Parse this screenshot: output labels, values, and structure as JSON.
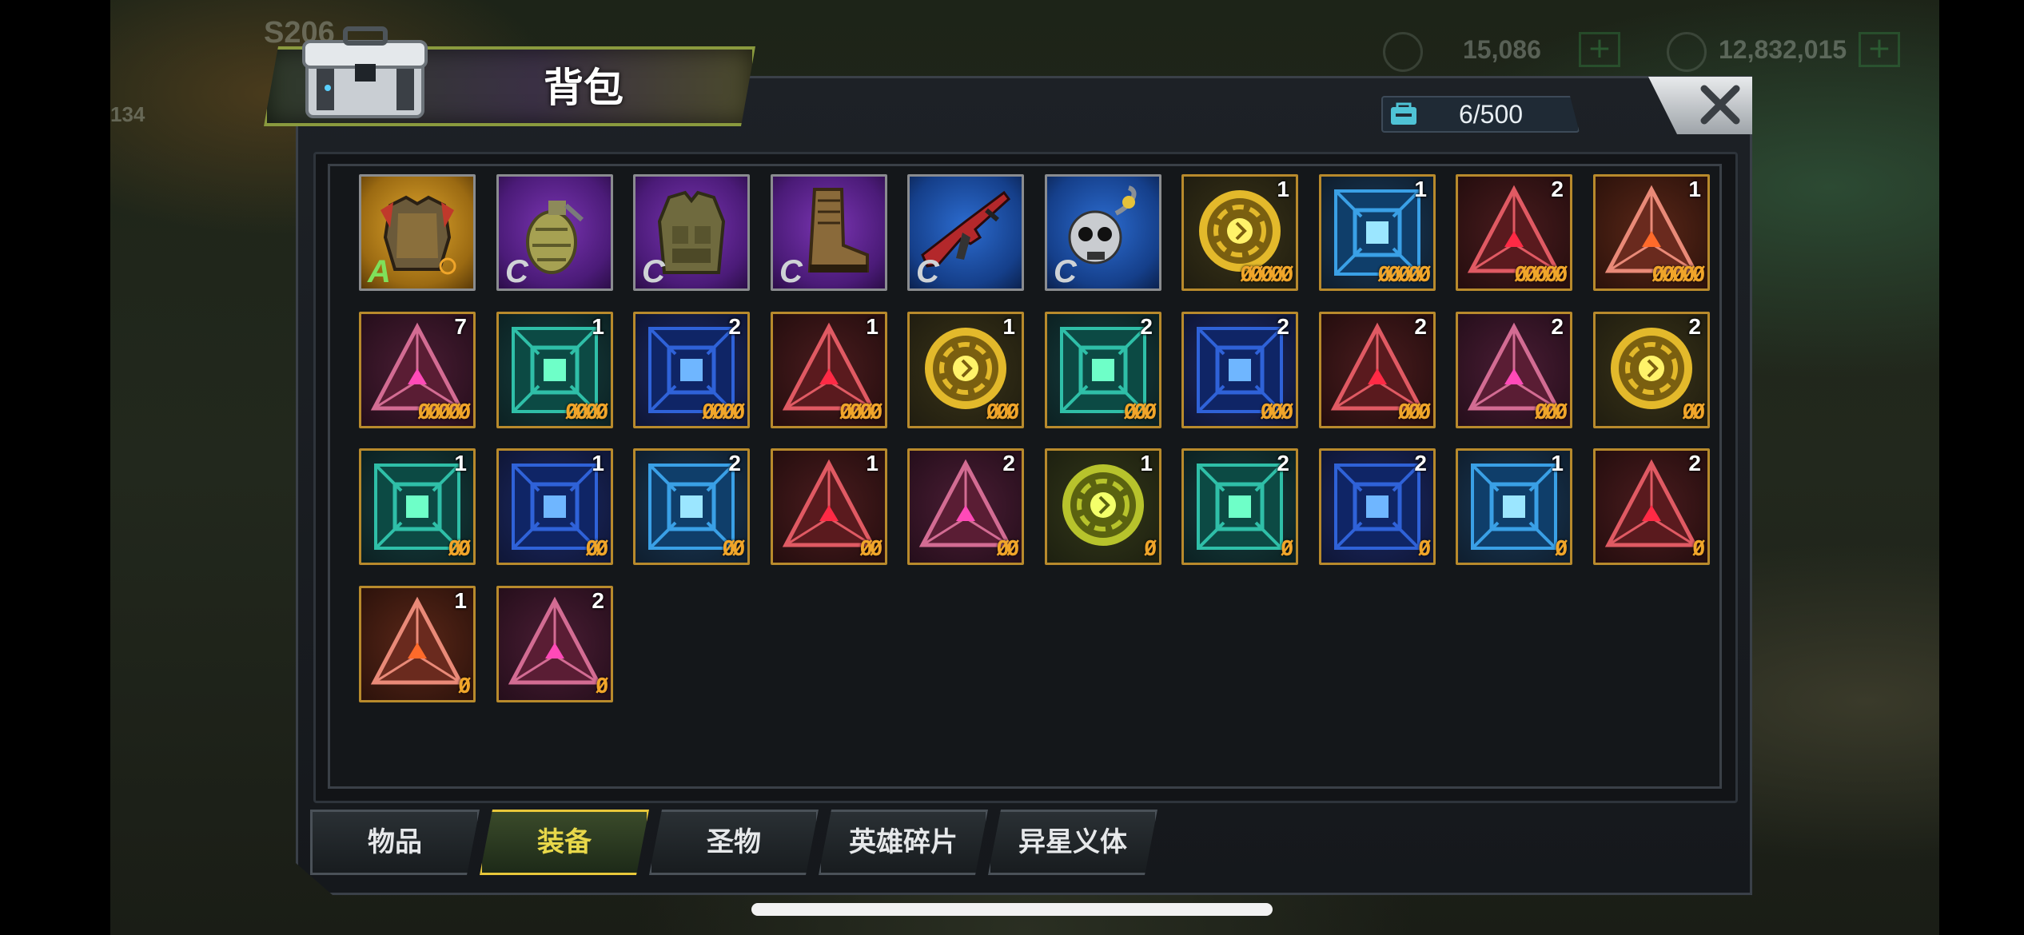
{
  "background": {
    "server_label": "S206",
    "level": "134",
    "resource_1": "15,086",
    "resource_2": "12,832,015"
  },
  "window": {
    "title": "背包",
    "capacity": "6/500",
    "close_label": "✕"
  },
  "colors": {
    "gold_rarity": "#c8921f",
    "purple_rarity": "#6a2a9a",
    "blue_rarity": "#1c4ea0",
    "teal_frame": "#2a8a8a",
    "red_frame": "#8a2424",
    "star": "#f0a52a",
    "tab_active": "#e8c73a"
  },
  "items": [
    {
      "kind": "armor",
      "bg": "gold",
      "grade": "A",
      "icon": "armor-icon",
      "count": "",
      "stars": ""
    },
    {
      "kind": "grenade",
      "bg": "purple",
      "grade": "C",
      "icon": "grenade-icon",
      "count": "",
      "stars": ""
    },
    {
      "kind": "vest",
      "bg": "purple",
      "grade": "C",
      "icon": "vest-icon",
      "count": "",
      "stars": ""
    },
    {
      "kind": "boot",
      "bg": "purple",
      "grade": "C",
      "icon": "boot-icon",
      "count": "",
      "stars": ""
    },
    {
      "kind": "rifle",
      "bg": "blue",
      "grade": "C",
      "icon": "rifle-icon",
      "count": "",
      "stars": ""
    },
    {
      "kind": "skull",
      "bg": "blue",
      "grade": "C",
      "icon": "skull-icon",
      "count": "",
      "stars": ""
    },
    {
      "kind": "gold-disc",
      "bg": "gold-chip",
      "grade": "",
      "icon": "gold-chip-icon",
      "count": "1",
      "stars": "ØØØØØ"
    },
    {
      "kind": "blue-square",
      "bg": "blue-chip",
      "grade": "",
      "icon": "blue-chip-icon",
      "count": "1",
      "stars": "ØØØØØ"
    },
    {
      "kind": "red-triangle",
      "bg": "red-chip",
      "grade": "",
      "icon": "red-chip-icon",
      "count": "2",
      "stars": "ØØØØØ"
    },
    {
      "kind": "orange-triangle",
      "bg": "orange-chip",
      "grade": "",
      "icon": "orange-chip-icon",
      "count": "1",
      "stars": "ØØØØØ"
    },
    {
      "kind": "pink-triangle",
      "bg": "pink-chip",
      "grade": "",
      "icon": "pink-chip-icon",
      "count": "7",
      "stars": "ØØØØØ"
    },
    {
      "kind": "teal-square",
      "bg": "teal-chip",
      "grade": "",
      "icon": "teal-chip-icon",
      "count": "1",
      "stars": "ØØØØ"
    },
    {
      "kind": "blue2-square",
      "bg": "blue2-chip",
      "grade": "",
      "icon": "blue-run-chip-icon",
      "count": "2",
      "stars": "ØØØØ"
    },
    {
      "kind": "red-triangle",
      "bg": "red-chip",
      "grade": "",
      "icon": "red-chip-icon",
      "count": "1",
      "stars": "ØØØØ"
    },
    {
      "kind": "gold-disc",
      "bg": "gold-chip",
      "grade": "",
      "icon": "gold-chip-icon",
      "count": "1",
      "stars": "ØØØ"
    },
    {
      "kind": "teal-square",
      "bg": "teal-chip",
      "grade": "",
      "icon": "teal-chip-icon",
      "count": "2",
      "stars": "ØØØ"
    },
    {
      "kind": "blue2-square",
      "bg": "blue2-chip",
      "grade": "",
      "icon": "blue-run-chip-icon",
      "count": "2",
      "stars": "ØØØ"
    },
    {
      "kind": "red-triangle",
      "bg": "red-chip",
      "grade": "",
      "icon": "red-chip-icon",
      "count": "2",
      "stars": "ØØØ"
    },
    {
      "kind": "pink-triangle",
      "bg": "pink-chip",
      "grade": "",
      "icon": "pink-chip-icon",
      "count": "2",
      "stars": "ØØØ"
    },
    {
      "kind": "gold-disc",
      "bg": "gold-chip",
      "grade": "",
      "icon": "gold-chip-icon",
      "count": "2",
      "stars": "ØØ"
    },
    {
      "kind": "teal-square",
      "bg": "teal-chip",
      "grade": "",
      "icon": "teal-chip-icon",
      "count": "1",
      "stars": "ØØ"
    },
    {
      "kind": "blue2-square",
      "bg": "blue2-chip",
      "grade": "",
      "icon": "blue-run-chip-icon",
      "count": "1",
      "stars": "ØØ"
    },
    {
      "kind": "blue-square",
      "bg": "blue-chip",
      "grade": "",
      "icon": "blue-chip-icon",
      "count": "2",
      "stars": "ØØ"
    },
    {
      "kind": "red-triangle",
      "bg": "red-chip",
      "grade": "",
      "icon": "red-chip-icon",
      "count": "1",
      "stars": "ØØ"
    },
    {
      "kind": "pink-triangle",
      "bg": "pink-chip",
      "grade": "",
      "icon": "pink-chip-icon",
      "count": "2",
      "stars": "ØØ"
    },
    {
      "kind": "green-disc",
      "bg": "green-chip",
      "grade": "",
      "icon": "green-chip-icon",
      "count": "1",
      "stars": "Ø"
    },
    {
      "kind": "teal-square",
      "bg": "teal-chip",
      "grade": "",
      "icon": "teal-chip-icon",
      "count": "2",
      "stars": "Ø"
    },
    {
      "kind": "blue2-square",
      "bg": "blue2-chip",
      "grade": "",
      "icon": "blue-run-chip-icon",
      "count": "2",
      "stars": "Ø"
    },
    {
      "kind": "blue-square",
      "bg": "blue-chip",
      "grade": "",
      "icon": "blue-chip-icon",
      "count": "1",
      "stars": "Ø"
    },
    {
      "kind": "red-triangle",
      "bg": "red-chip",
      "grade": "",
      "icon": "red-chip-icon",
      "count": "2",
      "stars": "Ø"
    },
    {
      "kind": "orange-triangle",
      "bg": "orange-chip",
      "grade": "",
      "icon": "orange-chip-icon",
      "count": "1",
      "stars": "Ø"
    },
    {
      "kind": "pink-triangle",
      "bg": "pink-chip",
      "grade": "",
      "icon": "pink-chip-icon",
      "count": "2",
      "stars": "Ø"
    }
  ],
  "tabs": [
    {
      "label": "物品",
      "active": false
    },
    {
      "label": "装备",
      "active": true
    },
    {
      "label": "圣物",
      "active": false
    },
    {
      "label": "英雄碎片",
      "active": false
    },
    {
      "label": "异星义体",
      "active": false
    }
  ]
}
